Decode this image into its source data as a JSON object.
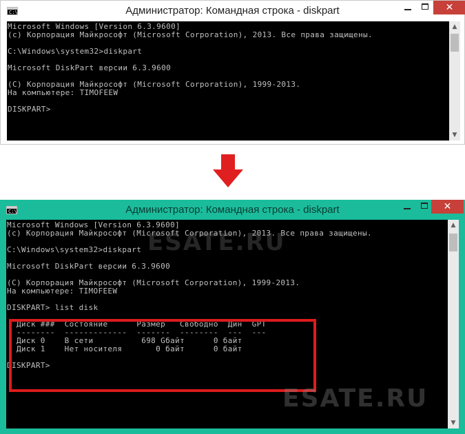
{
  "window_top": {
    "icon_glyph": "C:\\",
    "title": "Администратор: Командная строка - diskpart",
    "close_glyph": "✕",
    "console_lines": [
      "Microsoft Windows [Version 6.3.9600]",
      "(c) Корпорация Майкрософт (Microsoft Corporation), 2013. Все права защищены.",
      "",
      "C:\\Windows\\system32>diskpart",
      "",
      "Microsoft DiskPart версии 6.3.9600",
      "",
      "(C) Корпорация Майкрософт (Microsoft Corporation), 1999-2013.",
      "На компьютере: TIMOFEEW",
      "",
      "DISKPART>"
    ]
  },
  "window_bottom": {
    "icon_glyph": "C:\\",
    "title": "Администратор: Командная строка - diskpart",
    "close_glyph": "✕",
    "console_lines": [
      "Microsoft Windows [Version 6.3.9600]",
      "(c) Корпорация Майкрософт (Microsoft Corporation), 2013. Все права защищены.",
      "",
      "C:\\Windows\\system32>diskpart",
      "",
      "Microsoft DiskPart версии 6.3.9600",
      "",
      "(C) Корпорация Майкрософт (Microsoft Corporation), 1999-2013.",
      "На компьютере: TIMOFEEW",
      "",
      "DISKPART> list disk",
      "",
      "  Диск ###  Состояние      Размер   Свободно  Дин  GPT",
      "  --------  -------------  -------  --------  ---  ---",
      "  Диск 0    В сети          698 Gбайт      0 байт",
      "  Диск 1    Нет носителя       0 байт      0 байт",
      "",
      "DISKPART>"
    ]
  },
  "scroll_up_glyph": "▲",
  "scroll_down_glyph": "▼",
  "watermark_text": "ESATE.RU",
  "colors": {
    "window_active_frame": "#1bbc9b",
    "window_inactive_frame": "#ffffff",
    "console_bg": "#000000",
    "console_text": "#c0c0c0",
    "close_button": "#c7403a",
    "highlight_box": "#dd1c1c",
    "arrow": "#e02020"
  },
  "icons": {
    "app": "command-prompt-icon",
    "arrow": "arrow-down-icon"
  }
}
